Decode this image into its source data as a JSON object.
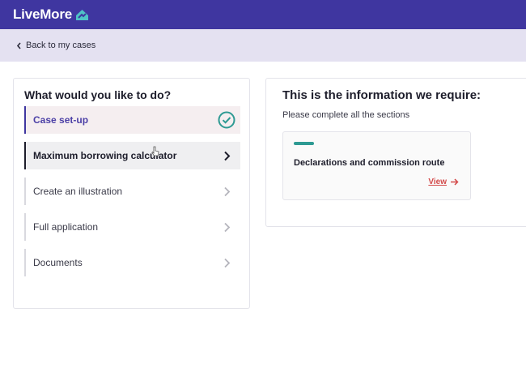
{
  "app": {
    "brand": "LiveMore"
  },
  "nav": {
    "back_label": "Back to my cases"
  },
  "left_panel": {
    "title": "What would you like to do?",
    "steps": [
      {
        "label": "Case set-up",
        "state": "complete",
        "icon": "check-circle-icon"
      },
      {
        "label": "Maximum borrowing calculator",
        "state": "active",
        "icon": "chevron-right-icon"
      },
      {
        "label": "Create an illustration",
        "state": "default",
        "icon": "chevron-right-icon"
      },
      {
        "label": "Full application",
        "state": "default",
        "icon": "chevron-right-icon"
      },
      {
        "label": "Documents",
        "state": "default",
        "icon": "chevron-right-icon"
      }
    ]
  },
  "right_panel": {
    "title": "This is the information we require:",
    "subtitle": "Please complete all the sections",
    "sections": [
      {
        "title": "Declarations and commission route",
        "link_label": "View",
        "icon": "arrow-right-icon"
      }
    ]
  },
  "colors": {
    "brand": "#3f36a0",
    "subbar": "#e4e1f1",
    "accent_teal": "#2e9a93",
    "link_red": "#d34a4a"
  }
}
